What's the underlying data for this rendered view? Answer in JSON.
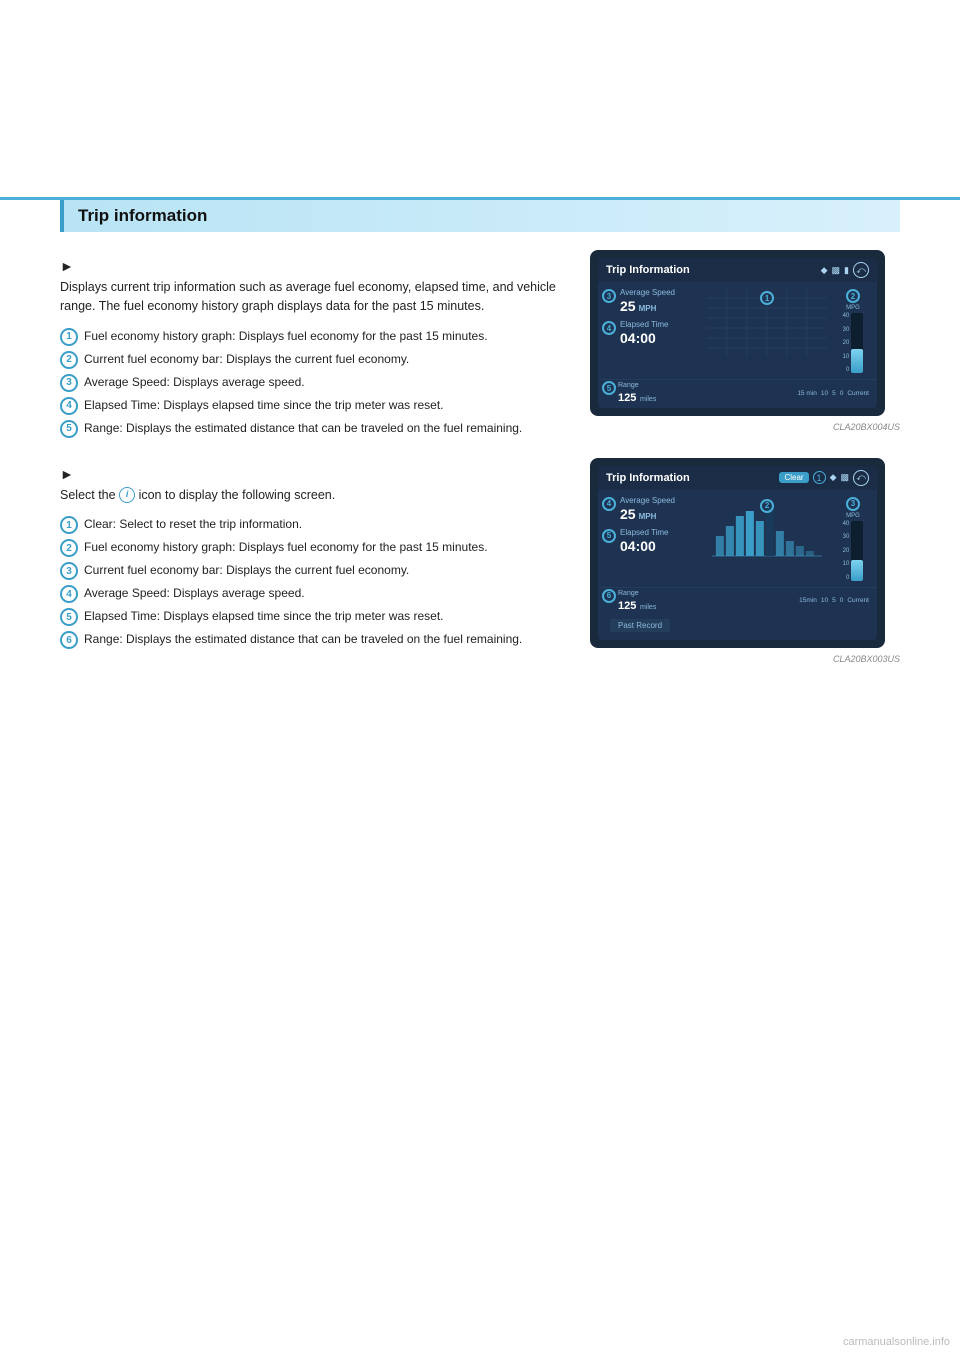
{
  "page": {
    "background": "#fff",
    "watermark": "carmanualsonline.info"
  },
  "section": {
    "title": "Trip information"
  },
  "block1": {
    "arrow": "►",
    "intro_text": "Displays current trip information such as average fuel economy, elapsed time, and vehicle range. The fuel economy history graph displays data for the past 15 minutes.",
    "items": [
      {
        "num": "1",
        "text": "Fuel economy history graph: Displays fuel economy for the past 15 minutes."
      },
      {
        "num": "2",
        "text": "Current fuel economy bar: Displays the current fuel economy."
      },
      {
        "num": "3",
        "text": "Average Speed: Displays average speed."
      },
      {
        "num": "4",
        "text": "Elapsed Time: Displays elapsed time since the trip meter was reset."
      },
      {
        "num": "5",
        "text": "Range: Displays the estimated distance that can be traveled on the fuel remaining."
      }
    ],
    "screen1": {
      "title": "Trip Information",
      "filename": "CLA20BX004US",
      "stats": {
        "avg_speed_label": "Average Speed",
        "avg_speed_value": "25",
        "avg_speed_unit": "MPH",
        "elapsed_label": "Elapsed Time",
        "elapsed_value": "04:00",
        "range_label": "Range",
        "range_value": "125",
        "range_unit": "miles"
      },
      "mpg_label": "MPG",
      "mpg_ticks": [
        "40",
        "30",
        "20",
        "10",
        "0"
      ],
      "time_axis": [
        "15 min",
        "10",
        "5",
        "0",
        "Current"
      ],
      "circle_num": "1",
      "circle2": "2",
      "circle3": "3",
      "circle4": "4",
      "circle5": "5"
    }
  },
  "block2": {
    "arrow": "►",
    "intro_text": "Select the",
    "intro_text2": "icon to display the following screen.",
    "items": [
      {
        "num": "1",
        "text": "Clear: Select to reset the trip information."
      },
      {
        "num": "2",
        "text": "Fuel economy history graph: Displays fuel economy for the past 15 minutes."
      },
      {
        "num": "3",
        "text": "Current fuel economy bar: Displays the current fuel economy."
      },
      {
        "num": "4",
        "text": "Average Speed: Displays average speed."
      },
      {
        "num": "5",
        "text": "Elapsed Time: Displays elapsed time since the trip meter was reset."
      },
      {
        "num": "6",
        "text": "Range: Displays the estimated distance that can be traveled on the fuel remaining."
      }
    ],
    "screen2": {
      "title": "Trip Information",
      "clear_label": "Clear",
      "filename": "CLA20BX003US",
      "stats": {
        "avg_speed_label": "Average Speed",
        "avg_speed_value": "25",
        "avg_speed_unit": "MPH",
        "elapsed_label": "Elapsed Time",
        "elapsed_value": "04:00",
        "range_label": "Range",
        "range_value": "125",
        "range_unit": "miles"
      },
      "mpg_label": "MPG",
      "mpg_ticks": [
        "40",
        "30",
        "20",
        "10",
        "0"
      ],
      "time_axis": [
        "15min",
        "10",
        "5",
        "0",
        "Current"
      ],
      "past_record_label": "Past Record",
      "circle1": "1",
      "circle2": "2",
      "circle3": "3",
      "circle4": "4",
      "circle5": "5",
      "circle6": "6"
    }
  }
}
